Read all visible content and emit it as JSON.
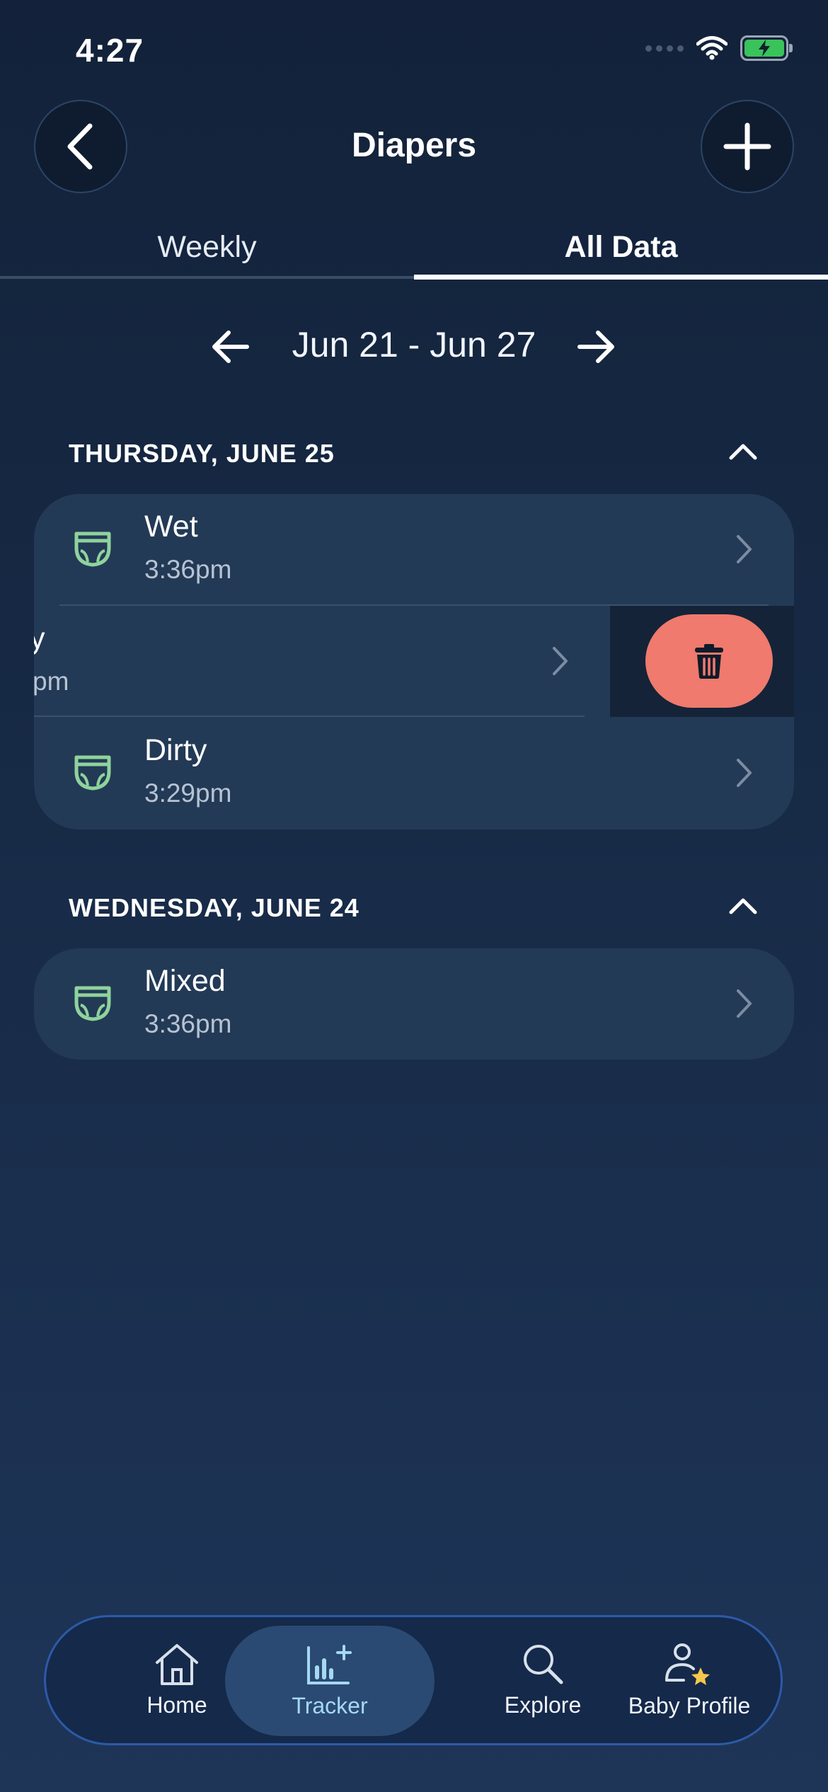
{
  "status_bar": {
    "time": "4:27"
  },
  "header": {
    "title": "Diapers",
    "back_icon": "chevron-left-icon",
    "add_icon": "plus-icon"
  },
  "tabs": [
    {
      "label": "Weekly",
      "active": false
    },
    {
      "label": "All Data",
      "active": true
    }
  ],
  "date_range": {
    "label": "Jun 21 - Jun 27"
  },
  "days": [
    {
      "header": "THURSDAY, JUNE 25",
      "entries": [
        {
          "type": "Wet",
          "time": "3:36pm"
        },
        {
          "type_partial": "y",
          "time_partial": "pm"
        },
        {
          "type": "Dirty",
          "time": "3:29pm"
        }
      ]
    },
    {
      "header": "WEDNESDAY, JUNE 24",
      "entries": [
        {
          "type": "Mixed",
          "time": "3:36pm"
        }
      ]
    }
  ],
  "tab_bar": {
    "items": [
      {
        "label": "Home",
        "icon": "home-icon",
        "active": false
      },
      {
        "label": "Tracker",
        "icon": "tracker-chart-icon",
        "active": true
      },
      {
        "label": "Explore",
        "icon": "search-icon",
        "active": false
      },
      {
        "label": "Baby Profile",
        "icon": "baby-profile-icon",
        "active": false
      }
    ]
  },
  "colors": {
    "background": "#13223a",
    "card": "#233a56",
    "diaper_icon": "#8fd39c",
    "delete": "#ef7a6d",
    "active_tab_text": "#a6d8f2"
  }
}
